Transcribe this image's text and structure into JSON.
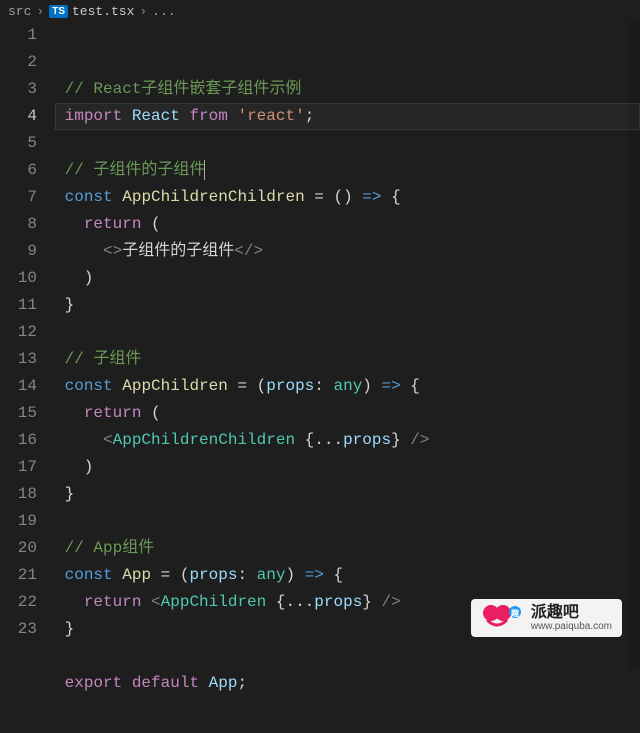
{
  "breadcrumb": {
    "folder": "src",
    "file": "test.tsx",
    "symbol": "..."
  },
  "ts_badge": "TS",
  "active_line": 4,
  "lines": [
    {
      "n": 1,
      "tokens": [
        [
          " ",
          "c-punc"
        ],
        [
          "// React子组件嵌套子组件示例",
          "c-comment"
        ]
      ]
    },
    {
      "n": 2,
      "tokens": [
        [
          " ",
          "c-punc"
        ],
        [
          "import",
          "c-keyword"
        ],
        [
          " ",
          "c-punc"
        ],
        [
          "React",
          "c-default"
        ],
        [
          " ",
          "c-punc"
        ],
        [
          "from",
          "c-keyword"
        ],
        [
          " ",
          "c-punc"
        ],
        [
          "'react'",
          "c-string"
        ],
        [
          ";",
          "c-punc"
        ]
      ]
    },
    {
      "n": 3,
      "tokens": []
    },
    {
      "n": 4,
      "tokens": [
        [
          " ",
          "c-punc"
        ],
        [
          "// 子组件的子组件",
          "c-comment"
        ]
      ],
      "cursor": true
    },
    {
      "n": 5,
      "tokens": [
        [
          " ",
          "c-punc"
        ],
        [
          "const",
          "c-const"
        ],
        [
          " ",
          "c-punc"
        ],
        [
          "AppChildrenChildren",
          "c-func"
        ],
        [
          " = () ",
          "c-punc"
        ],
        [
          "=>",
          "c-const"
        ],
        [
          " {",
          "c-punc"
        ]
      ]
    },
    {
      "n": 6,
      "tokens": [
        [
          "   ",
          "c-punc"
        ],
        [
          "return",
          "c-keyword"
        ],
        [
          " (",
          "c-punc"
        ]
      ]
    },
    {
      "n": 7,
      "tokens": [
        [
          "     ",
          "c-punc"
        ],
        [
          "<>",
          "c-jsx"
        ],
        [
          "子组件的子组件",
          "c-punc"
        ],
        [
          "</>",
          "c-jsx"
        ]
      ]
    },
    {
      "n": 8,
      "tokens": [
        [
          "   )",
          "c-punc"
        ]
      ]
    },
    {
      "n": 9,
      "tokens": [
        [
          " }",
          "c-punc"
        ]
      ]
    },
    {
      "n": 10,
      "tokens": []
    },
    {
      "n": 11,
      "tokens": [
        [
          " ",
          "c-punc"
        ],
        [
          "// 子组件",
          "c-comment"
        ]
      ]
    },
    {
      "n": 12,
      "tokens": [
        [
          " ",
          "c-punc"
        ],
        [
          "const",
          "c-const"
        ],
        [
          " ",
          "c-punc"
        ],
        [
          "AppChildren",
          "c-func"
        ],
        [
          " = (",
          "c-punc"
        ],
        [
          "props",
          "c-var"
        ],
        [
          ": ",
          "c-punc"
        ],
        [
          "any",
          "c-type"
        ],
        [
          ") ",
          "c-punc"
        ],
        [
          "=>",
          "c-const"
        ],
        [
          " {",
          "c-punc"
        ]
      ]
    },
    {
      "n": 13,
      "tokens": [
        [
          "   ",
          "c-punc"
        ],
        [
          "return",
          "c-keyword"
        ],
        [
          " (",
          "c-punc"
        ]
      ]
    },
    {
      "n": 14,
      "tokens": [
        [
          "     ",
          "c-punc"
        ],
        [
          "<",
          "c-jsx"
        ],
        [
          "AppChildrenChildren",
          "c-type"
        ],
        [
          " {...",
          "c-punc"
        ],
        [
          "props",
          "c-var"
        ],
        [
          "} ",
          "c-punc"
        ],
        [
          "/>",
          "c-jsx"
        ]
      ]
    },
    {
      "n": 15,
      "tokens": [
        [
          "   )",
          "c-punc"
        ]
      ]
    },
    {
      "n": 16,
      "tokens": [
        [
          " }",
          "c-punc"
        ]
      ]
    },
    {
      "n": 17,
      "tokens": []
    },
    {
      "n": 18,
      "tokens": [
        [
          " ",
          "c-punc"
        ],
        [
          "// App组件",
          "c-comment"
        ]
      ]
    },
    {
      "n": 19,
      "tokens": [
        [
          " ",
          "c-punc"
        ],
        [
          "const",
          "c-const"
        ],
        [
          " ",
          "c-punc"
        ],
        [
          "App",
          "c-func"
        ],
        [
          " = (",
          "c-punc"
        ],
        [
          "props",
          "c-var"
        ],
        [
          ": ",
          "c-punc"
        ],
        [
          "any",
          "c-type"
        ],
        [
          ") ",
          "c-punc"
        ],
        [
          "=>",
          "c-const"
        ],
        [
          " {",
          "c-punc"
        ]
      ]
    },
    {
      "n": 20,
      "tokens": [
        [
          "   ",
          "c-punc"
        ],
        [
          "return",
          "c-keyword"
        ],
        [
          " ",
          "c-punc"
        ],
        [
          "<",
          "c-jsx"
        ],
        [
          "AppChildren",
          "c-type"
        ],
        [
          " {...",
          "c-punc"
        ],
        [
          "props",
          "c-var"
        ],
        [
          "} ",
          "c-punc"
        ],
        [
          "/>",
          "c-jsx"
        ]
      ]
    },
    {
      "n": 21,
      "tokens": [
        [
          " }",
          "c-punc"
        ]
      ]
    },
    {
      "n": 22,
      "tokens": []
    },
    {
      "n": 23,
      "tokens": [
        [
          " ",
          "c-punc"
        ],
        [
          "export",
          "c-keyword"
        ],
        [
          " ",
          "c-punc"
        ],
        [
          "default",
          "c-keyword"
        ],
        [
          " ",
          "c-punc"
        ],
        [
          "App",
          "c-var"
        ],
        [
          ";",
          "c-punc"
        ]
      ]
    }
  ],
  "watermark": {
    "title": "派趣吧",
    "url": "www.paiquba.com"
  }
}
